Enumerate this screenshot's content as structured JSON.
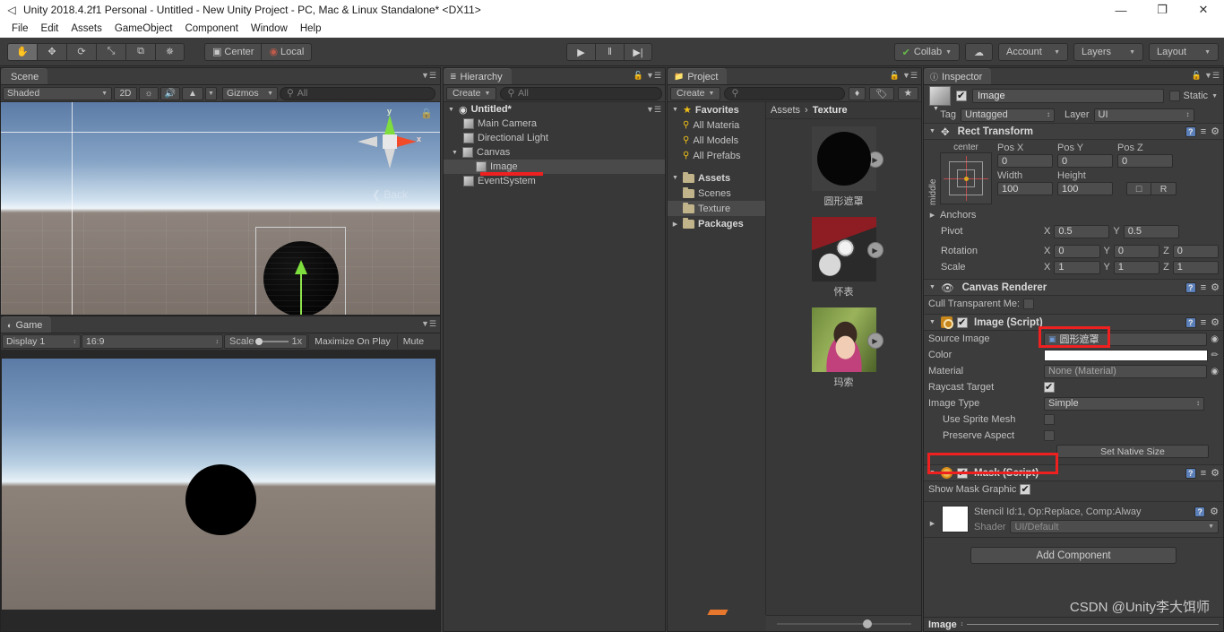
{
  "window": {
    "title": "Unity 2018.4.2f1 Personal - Untitled - New Unity Project - PC, Mac & Linux Standalone* <DX11>",
    "app_icon": "unity-logo-icon",
    "minimize": "—",
    "maximize": "❐",
    "close": "✕"
  },
  "menubar": {
    "items": [
      "File",
      "Edit",
      "Assets",
      "GameObject",
      "Component",
      "Window",
      "Help"
    ]
  },
  "toolbar": {
    "transform_tools": [
      {
        "name": "hand-tool",
        "glyph": "✋",
        "active": true
      },
      {
        "name": "move-tool",
        "glyph": "✥",
        "active": false
      },
      {
        "name": "rotate-tool",
        "glyph": "⟳",
        "active": false
      },
      {
        "name": "scale-tool",
        "glyph": "⤡",
        "active": false
      },
      {
        "name": "rect-tool",
        "glyph": "⧉",
        "active": false
      },
      {
        "name": "transform-tool",
        "glyph": "✵",
        "active": false
      }
    ],
    "pivot_label": "Center",
    "rotation_label": "Local",
    "play": "▶",
    "pause": "‖",
    "step": "▶|",
    "collab_label": "Collab",
    "cloud_icon": "cloud-icon",
    "account_label": "Account",
    "layers_label": "Layers",
    "layout_label": "Layout"
  },
  "scene": {
    "tab_label": "Scene",
    "tab_icon": "scene-icon",
    "draw_mode": "Shaded",
    "mode_2d": "2D",
    "lighting_icon": "light-icon",
    "audio_icon": "audio-icon",
    "effects_icon": "fx-icon",
    "gizmos_label": "Gizmos",
    "search_placeholder": "All",
    "gizmo_axis_y": "y",
    "gizmo_axis_x": "x",
    "gizmo_view_label": "Back"
  },
  "game": {
    "tab_label": "Game",
    "tab_icon": "game-icon",
    "display": "Display 1",
    "aspect": "16:9",
    "scale_label": "Scale",
    "scale_value": "1x",
    "maximize_label": "Maximize On Play",
    "mute_label": "Mute"
  },
  "hierarchy": {
    "tab_label": "Hierarchy",
    "tab_icon": "hierarchy-icon",
    "create_label": "Create",
    "search_placeholder": "All",
    "scene_name": "Untitled*",
    "items": [
      {
        "label": "Main Camera",
        "depth": 1,
        "expandable": false,
        "selected": false
      },
      {
        "label": "Directional Light",
        "depth": 1,
        "expandable": false,
        "selected": false
      },
      {
        "label": "Canvas",
        "depth": 1,
        "expandable": true,
        "selected": false
      },
      {
        "label": "Image",
        "depth": 2,
        "expandable": false,
        "selected": true
      },
      {
        "label": "EventSystem",
        "depth": 1,
        "expandable": false,
        "selected": false
      }
    ]
  },
  "project": {
    "tab_label": "Project",
    "tab_icon": "folder-icon",
    "create_label": "Create",
    "search_placeholder": "",
    "tree": [
      {
        "label": "Favorites",
        "icon": "star-icon",
        "depth": 0,
        "expandable": true,
        "bold": true,
        "selected": false
      },
      {
        "label": "All Materia",
        "icon": "search-icon",
        "depth": 1,
        "expandable": false,
        "bold": false,
        "selected": false
      },
      {
        "label": "All Models",
        "icon": "search-icon",
        "depth": 1,
        "expandable": false,
        "bold": false,
        "selected": false
      },
      {
        "label": "All Prefabs",
        "icon": "search-icon",
        "depth": 1,
        "expandable": false,
        "bold": false,
        "selected": false
      },
      {
        "label": "Assets",
        "icon": "folder-icon",
        "depth": 0,
        "expandable": true,
        "bold": true,
        "selected": false
      },
      {
        "label": "Scenes",
        "icon": "folder-icon",
        "depth": 1,
        "expandable": false,
        "bold": false,
        "selected": false
      },
      {
        "label": "Texture",
        "icon": "folder-icon",
        "depth": 1,
        "expandable": false,
        "bold": false,
        "selected": true
      },
      {
        "label": "Packages",
        "icon": "folder-icon",
        "depth": 0,
        "expandable": true,
        "bold": true,
        "selected": false
      }
    ],
    "breadcrumb_root": "Assets",
    "breadcrumb_sep": "›",
    "breadcrumb_current": "Texture",
    "assets": [
      {
        "label": "圆形遮罩",
        "kind": "circle-mask"
      },
      {
        "label": "怀表",
        "kind": "watch"
      },
      {
        "label": "玛索",
        "kind": "portrait"
      }
    ]
  },
  "inspector": {
    "tab_label": "Inspector",
    "tab_icon": "info-icon",
    "object_name": "Image",
    "enabled": true,
    "static_label": "Static",
    "tag_label": "Tag",
    "tag_value": "Untagged",
    "layer_label": "Layer",
    "layer_value": "UI",
    "rect_transform": {
      "title": "Rect Transform",
      "anchor_preset_h": "center",
      "anchor_preset_v": "middle",
      "pos_x_label": "Pos X",
      "pos_x": "0",
      "pos_y_label": "Pos Y",
      "pos_y": "0",
      "pos_z_label": "Pos Z",
      "pos_z": "0",
      "width_label": "Width",
      "width": "100",
      "height_label": "Height",
      "height": "100",
      "blueprint_btn": "blueprint-icon",
      "raw_btn": "R",
      "anchors_label": "Anchors",
      "pivot_label": "Pivot",
      "pivot_x": "0.5",
      "pivot_y": "0.5",
      "rotation_label": "Rotation",
      "rot_x": "0",
      "rot_y": "0",
      "rot_z": "0",
      "scale_label": "Scale",
      "scale_x": "1",
      "scale_y": "1",
      "scale_z": "1"
    },
    "canvas_renderer": {
      "title": "Canvas Renderer",
      "cull_label": "Cull Transparent Me:",
      "cull_value": false
    },
    "image_script": {
      "title": "Image (Script)",
      "enabled": true,
      "source_image_label": "Source Image",
      "source_image_value": "圆形遮罩",
      "color_label": "Color",
      "color_value": "#FFFFFF",
      "material_label": "Material",
      "material_value": "None (Material)",
      "raycast_label": "Raycast Target",
      "raycast_value": true,
      "image_type_label": "Image Type",
      "image_type_value": "Simple",
      "use_sprite_mesh_label": "Use Sprite Mesh",
      "use_sprite_mesh_value": false,
      "preserve_aspect_label": "Preserve Aspect",
      "preserve_aspect_value": false,
      "set_native_size_label": "Set Native Size"
    },
    "mask_script": {
      "title": "Mask (Script)",
      "enabled": true,
      "show_mask_graphic_label": "Show Mask Graphic",
      "show_mask_graphic_value": true
    },
    "material_preview": {
      "title": "Stencil Id:1, Op:Replace, Comp:Alway",
      "shader_label": "Shader",
      "shader_value": "UI/Default"
    },
    "add_component_label": "Add Component",
    "footer_name": "Image"
  },
  "watermark": "CSDN @Unity李大饵师",
  "colors": {
    "accent_red": "#ef2020",
    "axis_x": "#f14b2a",
    "axis_y": "#7ede3d",
    "panel_bg": "#383838",
    "toolbar_bg": "#3c3c3c",
    "selection": "#4a4a4a",
    "favorite_star": "#f2c017"
  }
}
